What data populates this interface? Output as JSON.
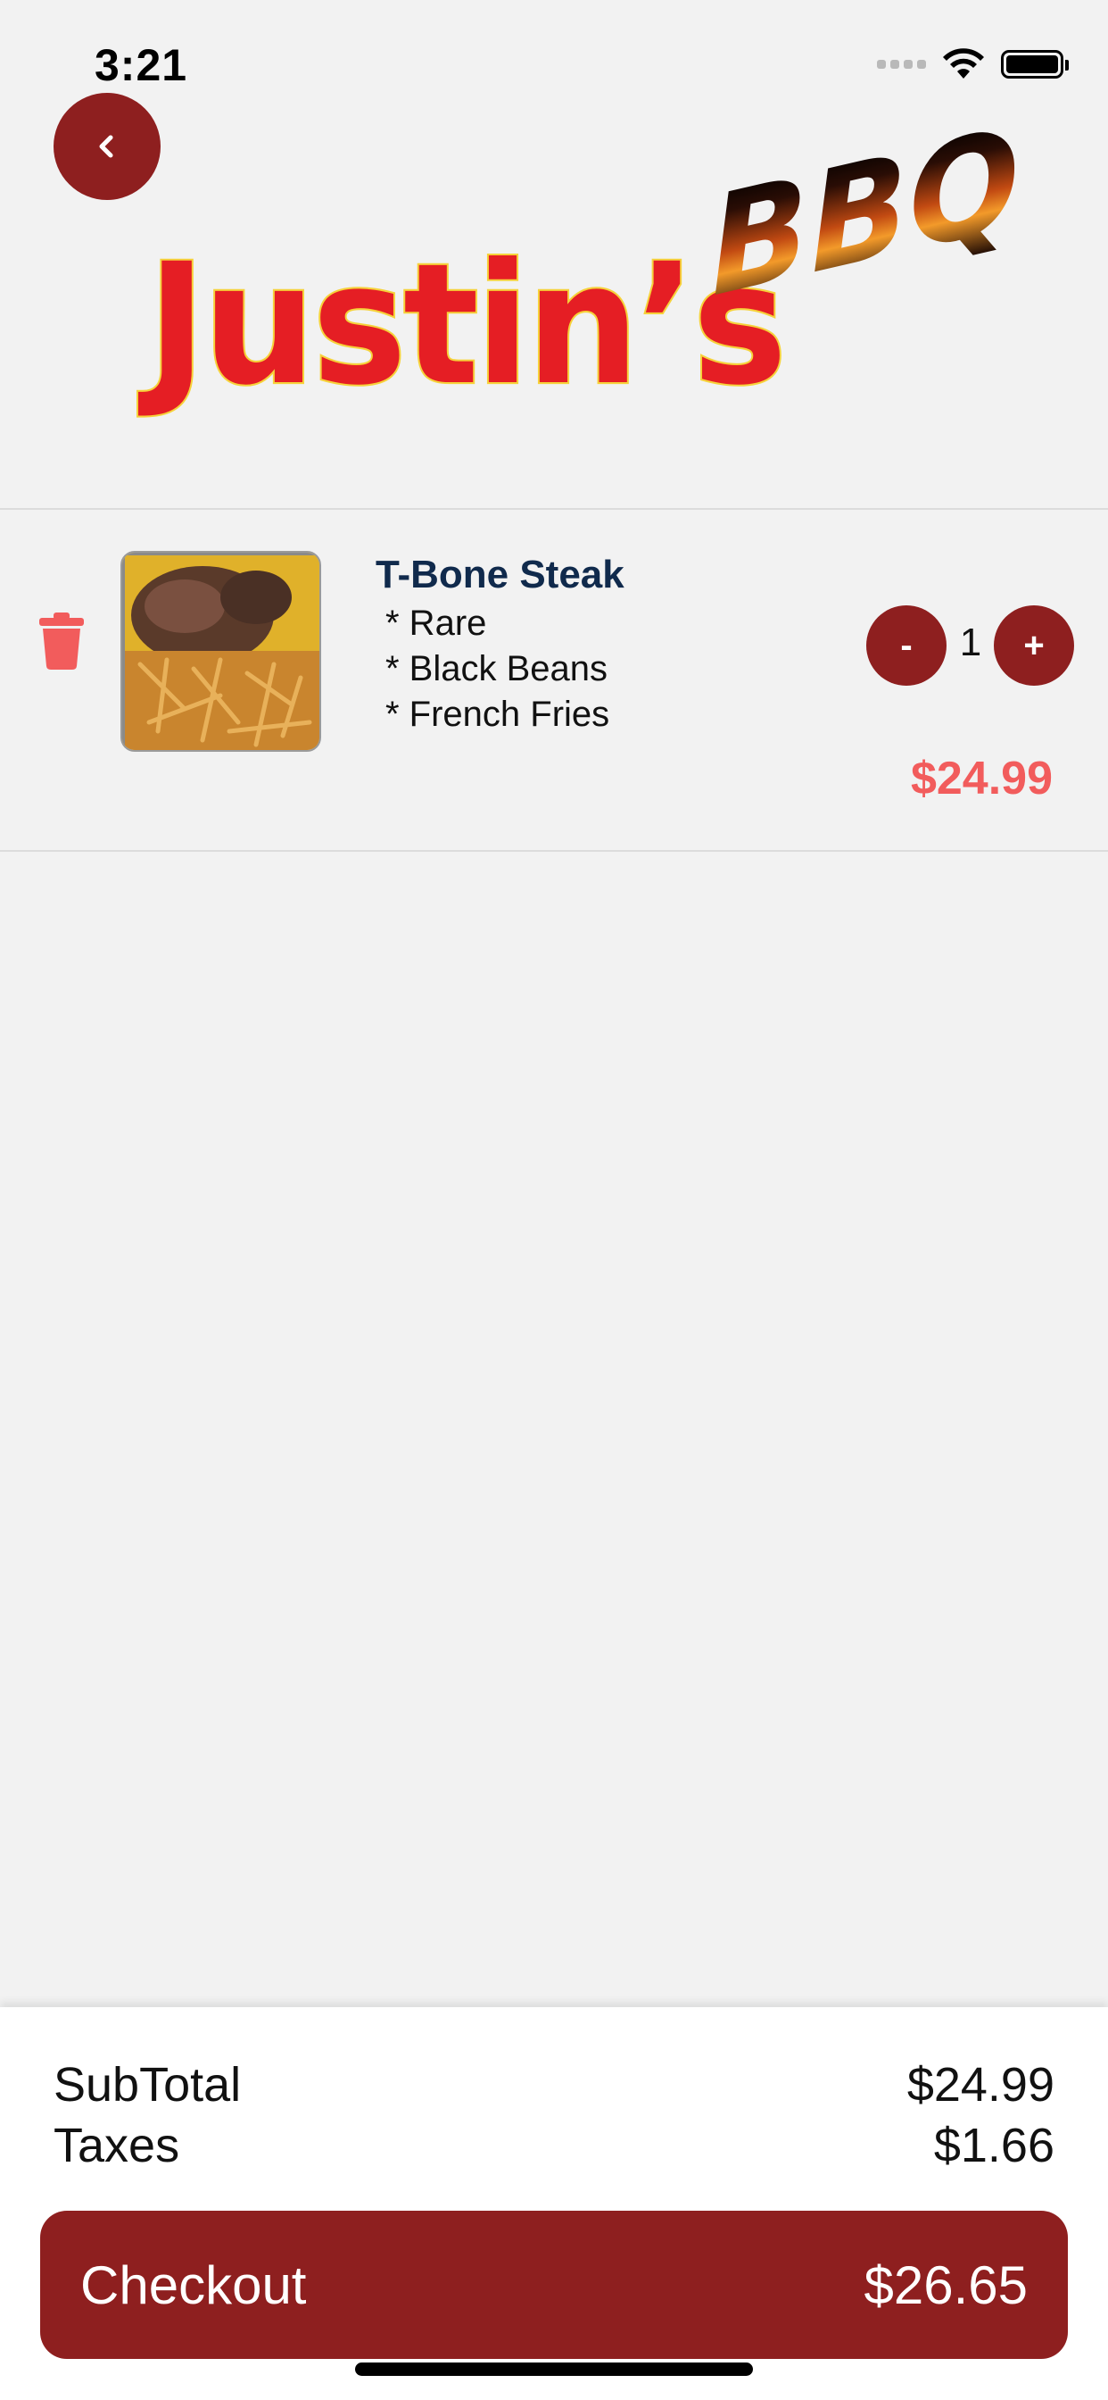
{
  "status_bar": {
    "time": "3:21",
    "icons": [
      "signal-icon",
      "wifi-icon",
      "battery-icon"
    ]
  },
  "header": {
    "back_icon": "chevron-left-icon",
    "logo_text": "Justin's BBQ"
  },
  "cart": {
    "items": [
      {
        "name": "T-Bone Steak",
        "options": [
          "* Rare",
          "* Black Beans",
          "* French Fries"
        ],
        "quantity": "1",
        "decrement_label": "-",
        "increment_label": "+",
        "price": "$24.99",
        "delete_icon": "trash-icon"
      }
    ]
  },
  "summary": {
    "subtotal_label": "SubTotal",
    "subtotal_value": "$24.99",
    "taxes_label": "Taxes",
    "taxes_value": "$1.66",
    "checkout_label": "Checkout",
    "checkout_total": "$26.65"
  },
  "colors": {
    "accent": "#8e1f1f",
    "price": "#f25c5c",
    "item_name": "#102a4c",
    "background": "#f2f2f2"
  }
}
